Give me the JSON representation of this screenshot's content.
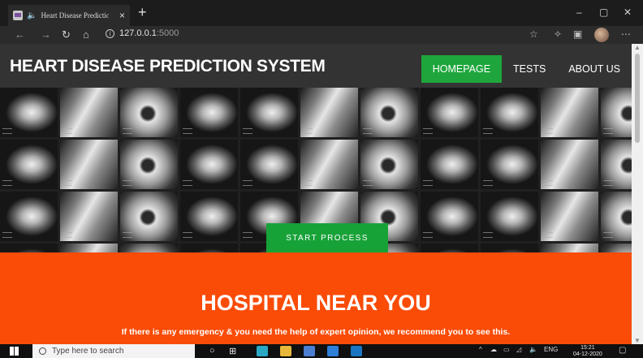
{
  "browser": {
    "tab_title": "Heart Disease Prediction Sy",
    "tab_close": "×",
    "new_tab": "+",
    "url_host": "127.0.0.1",
    "url_port": ":5000",
    "window_controls": [
      "–",
      "▢",
      "✕"
    ]
  },
  "site": {
    "brand": "HEART DISEASE PREDICTION SYSTEM",
    "nav": [
      {
        "label": "HOMEPAGE",
        "active": true
      },
      {
        "label": "TESTS",
        "active": false
      },
      {
        "label": "ABOUT US",
        "active": false
      }
    ],
    "hero_button": "START PROCESS",
    "section_title": "HOSPITAL NEAR YOU",
    "section_text": "If there is any emergency & you need the help of expert opinion, we recommend you to see this.",
    "colors": {
      "header_bg": "#333333",
      "accent_green": "#1ea63c",
      "section_orange": "#fa4c07"
    }
  },
  "taskbar": {
    "search_placeholder": "Type here to search",
    "language": "ENG",
    "time": "15:21",
    "date": "04-12-2020"
  }
}
